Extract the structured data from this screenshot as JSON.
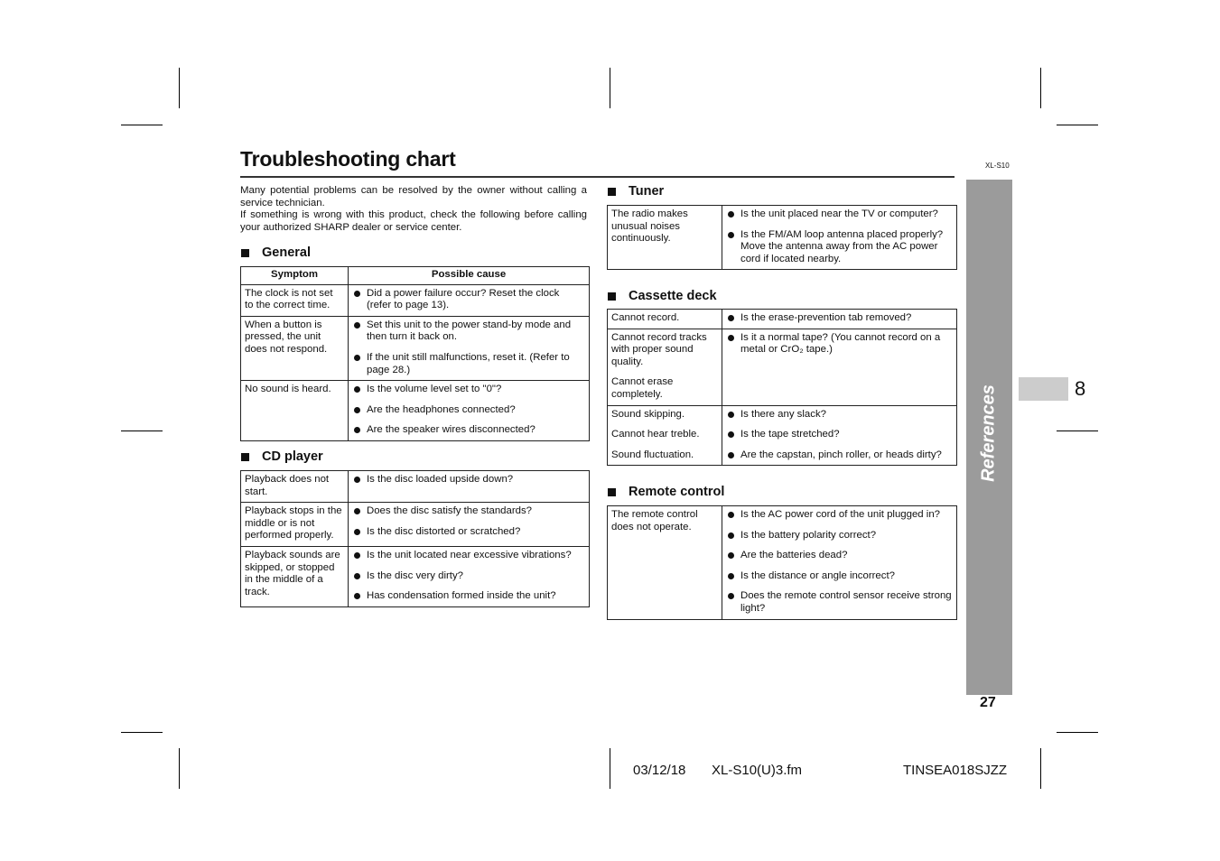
{
  "page": {
    "title": "Troubleshooting chart",
    "model_code": "XL-S10",
    "side_label": "References",
    "chapter_number": "8",
    "page_number": "27"
  },
  "intro": {
    "paragraph1": "Many potential problems can be resolved by the owner without calling a service technician.",
    "paragraph2": "If something is wrong with this product, check the following before calling your authorized SHARP dealer or service center."
  },
  "sections": {
    "general": {
      "heading": "General",
      "header_symptom": "Symptom",
      "header_cause": "Possible cause",
      "rows": [
        {
          "symptoms": [
            "The clock is not set to the correct time."
          ],
          "causes": [
            "Did a power failure occur? Reset the clock (refer to page 13)."
          ]
        },
        {
          "symptoms": [
            "When a button is pressed, the unit does not respond."
          ],
          "causes": [
            "Set this unit to the power stand-by mode and then turn it back on.",
            "If the unit still malfunctions, reset it. (Refer to page 28.)"
          ]
        },
        {
          "symptoms": [
            "No sound is heard."
          ],
          "causes": [
            "Is the volume level set to \"0\"?",
            "Are the headphones connected?",
            "Are the speaker wires disconnected?"
          ]
        }
      ]
    },
    "cd_player": {
      "heading": "CD player",
      "rows": [
        {
          "symptoms": [
            "Playback does not start."
          ],
          "causes": [
            "Is the disc loaded upside down?"
          ]
        },
        {
          "symptoms": [
            "Playback stops in the middle or is not performed properly."
          ],
          "causes": [
            "Does the disc satisfy the standards?",
            "Is the disc distorted or scratched?"
          ]
        },
        {
          "symptoms": [
            "Playback sounds are skipped, or stopped in the middle of a track."
          ],
          "causes": [
            "Is the unit located near excessive vibrations?",
            "Is the disc very dirty?",
            "Has condensation formed inside the unit?"
          ]
        }
      ]
    },
    "tuner": {
      "heading": "Tuner",
      "rows": [
        {
          "symptoms": [
            "The radio makes unusual noises continuously."
          ],
          "causes": [
            "Is the unit placed near the TV or computer?",
            "Is the FM/AM loop antenna placed properly? Move the antenna away from the AC power cord if located nearby."
          ]
        }
      ]
    },
    "cassette_deck": {
      "heading": "Cassette deck",
      "rows": [
        {
          "symptoms": [
            "Cannot record."
          ],
          "causes": [
            "Is the erase-prevention tab removed?"
          ]
        },
        {
          "symptoms": [
            "Cannot record tracks with proper sound quality.",
            "Cannot erase completely."
          ],
          "causes": [
            "Is it a normal tape? (You cannot record on a metal or CrO₂ tape.)"
          ]
        },
        {
          "symptoms": [
            "Sound skipping.",
            "Cannot hear treble.",
            "Sound fluctuation."
          ],
          "causes": [
            "Is there any slack?",
            "Is the tape stretched?",
            "Are the capstan, pinch roller, or heads dirty?"
          ]
        }
      ]
    },
    "remote_control": {
      "heading": "Remote control",
      "rows": [
        {
          "symptoms": [
            "The remote control does not operate."
          ],
          "causes": [
            "Is the AC power cord of the unit plugged in?",
            "Is the battery polarity correct?",
            "Are the batteries dead?",
            "Is the distance or angle incorrect?",
            "Does the remote control sensor receive strong light?"
          ]
        }
      ]
    }
  },
  "footer": {
    "date": "03/12/18",
    "filename": "XL-S10(U)3.fm",
    "doc_code": "TINSEA018SJZZ"
  }
}
